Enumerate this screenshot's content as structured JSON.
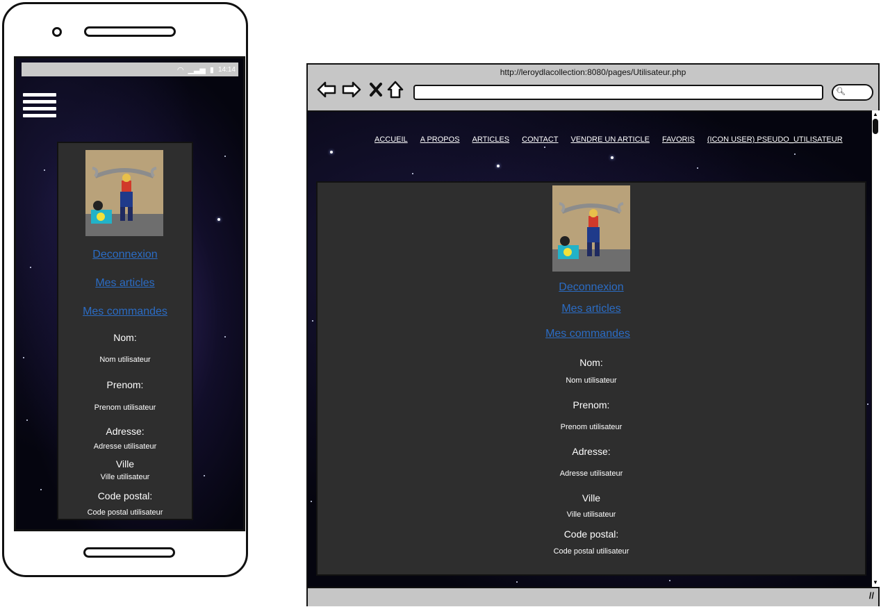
{
  "mobile": {
    "status_bar": {
      "time": "14:14"
    },
    "links": {
      "logout": "Deconnexion",
      "my_articles": "Mes articles",
      "my_orders": "Mes commandes"
    },
    "fields": {
      "nom_label": "Nom:",
      "nom_value": "Nom utilisateur",
      "prenom_label": "Prenom:",
      "prenom_value": "Prenom utilisateur",
      "adresse_label": "Adresse:",
      "adresse_value": "Adresse utilisateur",
      "ville_label": "Ville",
      "ville_value": "Ville utilisateur",
      "cp_label": "Code postal:",
      "cp_value": "Code postal utilisateur"
    }
  },
  "desktop": {
    "url": "http://leroydlacollection:8080/pages/Utilisateur.php",
    "nav": {
      "accueil": "ACCUEIL",
      "apropos": "A PROPOS",
      "articles": "ARTICLES",
      "contact": "CONTACT",
      "vendre": "VENDRE UN ARTICLE",
      "favoris": "FAVORIS",
      "user": "(ICON USER) PSEUDO_UTILISATEUR"
    },
    "links": {
      "logout": "Deconnexion",
      "my_articles": "Mes articles",
      "my_orders": "Mes commandes"
    },
    "fields": {
      "nom_label": "Nom:",
      "nom_value": "Nom utilisateur",
      "prenom_label": "Prenom:",
      "prenom_value": "Prenom utilisateur",
      "adresse_label": "Adresse:",
      "adresse_value": "Adresse utilisateur",
      "ville_label": "Ville",
      "ville_value": "Ville utilisateur",
      "cp_label": "Code postal:",
      "cp_value": "Code postal utilisateur"
    }
  },
  "colors": {
    "link": "#2b6cc4",
    "panel": "#2e2e2e",
    "space": "#05050f",
    "chrome": "#c6c6c6"
  },
  "icons": [
    "wifi-icon",
    "signal-icon",
    "battery-icon",
    "hamburger-menu-icon",
    "back-arrow-icon",
    "forward-arrow-icon",
    "close-x-icon",
    "home-icon",
    "search-icon",
    "resize-grip-icon"
  ]
}
